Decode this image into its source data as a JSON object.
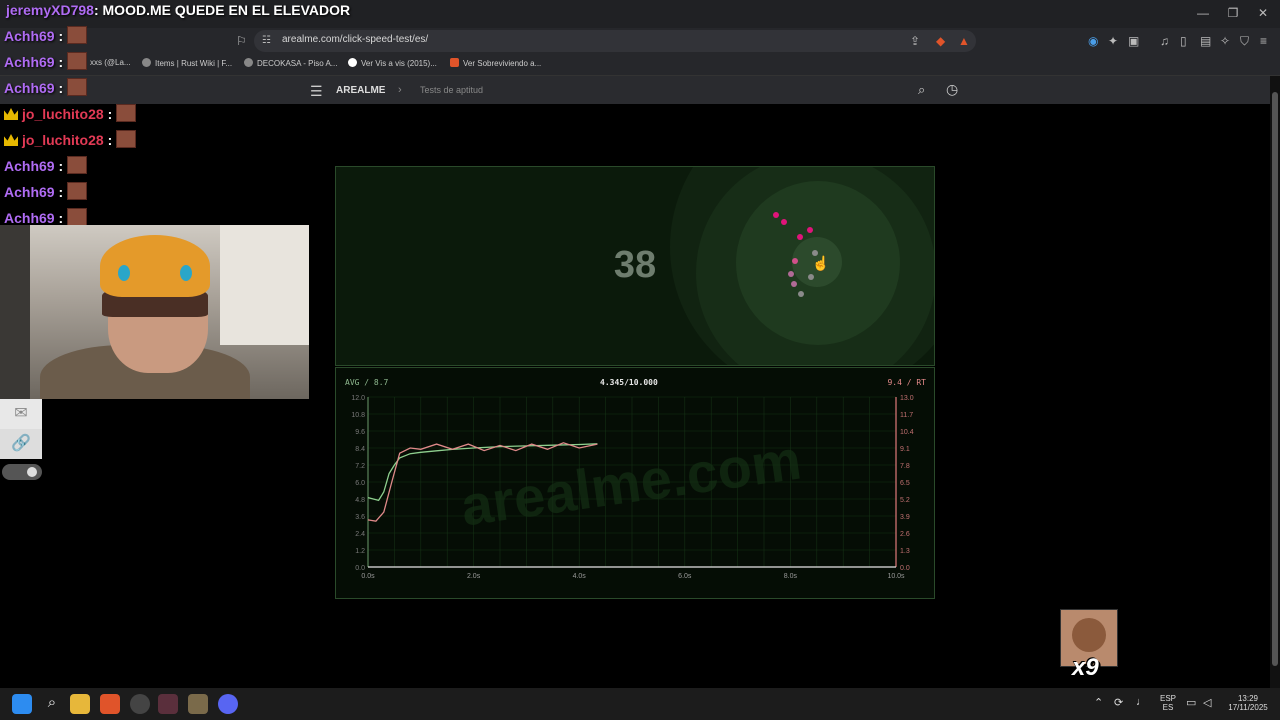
{
  "stream": {
    "title_user": "jeremyXD798",
    "title_sep": ": ",
    "title_text": "MOOD.ME QUEDE EN EL ELEVADOR",
    "chat": [
      {
        "user": "Achh69",
        "sep": ":"
      },
      {
        "user": "Achh69",
        "sep": ":"
      },
      {
        "user": "Achh69",
        "sep": ":"
      },
      {
        "user": "jo_luchito28",
        "sep": ":",
        "badge": "crown-icon"
      },
      {
        "user": "jo_luchito28",
        "sep": ":",
        "badge": "crown-icon"
      },
      {
        "user": "Achh69",
        "sep": ":"
      },
      {
        "user": "Achh69",
        "sep": ":"
      },
      {
        "user": "Achh69",
        "sep": ":"
      }
    ],
    "meme_multiplier": "x9"
  },
  "browser": {
    "url": "arealme.com/click-speed-test/es/",
    "bookmarks": [
      "xxs (@La...",
      "Items | Rust Wiki | F...",
      "DECOKASA - Piso A...",
      "Ver Vis a vis (2015)...",
      "Ver Sobreviviendo a..."
    ],
    "window_controls": [
      "—",
      "❐",
      "✕"
    ]
  },
  "site": {
    "brand": "AREALME",
    "breadcrumb": "Tests de aptitud",
    "click_count": "38",
    "avg_label": "AVG / 8.7",
    "progress_label": "4.345/10.000",
    "rt_label": "9.4 / RT"
  },
  "taskbar": {
    "lang_top": "ESP",
    "lang_bottom": "ES",
    "time": "13:29",
    "date": "17/11/2025"
  },
  "colors": {
    "avg_line": "#8fd08f",
    "rt_line": "#e08a8a",
    "click_dot": "#e0147a",
    "grid": "#143014"
  },
  "chart_data": {
    "type": "line",
    "xlim": [
      0,
      10
    ],
    "ylim_left": [
      0,
      12
    ],
    "ylim_right": [
      0,
      13
    ],
    "x_ticks": [
      "0.0s",
      "2.0s",
      "4.0s",
      "6.0s",
      "8.0s",
      "10.0s"
    ],
    "y_ticks_left": [
      "0.0",
      "1.2",
      "2.4",
      "3.6",
      "4.8",
      "6.0",
      "7.2",
      "8.4",
      "9.6",
      "10.8",
      "12.0"
    ],
    "y_ticks_right": [
      "0.0",
      "1.3",
      "2.6",
      "3.9",
      "5.2",
      "6.5",
      "7.8",
      "9.1",
      "10.4",
      "11.7",
      "13.0"
    ],
    "watermark": "arealme.com",
    "series": [
      {
        "name": "AVG",
        "axis": "left",
        "x": [
          0.0,
          0.1,
          0.2,
          0.3,
          0.4,
          0.5,
          0.6,
          0.8,
          1.0,
          1.3,
          1.6,
          2.0,
          2.5,
          3.0,
          3.5,
          4.0,
          4.345
        ],
        "y": [
          4.9,
          4.8,
          4.7,
          5.3,
          6.6,
          7.2,
          7.7,
          8.0,
          8.1,
          8.2,
          8.3,
          8.4,
          8.5,
          8.55,
          8.6,
          8.65,
          8.7
        ]
      },
      {
        "name": "RT",
        "axis": "right",
        "x": [
          0.0,
          0.15,
          0.3,
          0.45,
          0.6,
          0.8,
          1.0,
          1.3,
          1.6,
          1.9,
          2.2,
          2.5,
          2.8,
          3.1,
          3.4,
          3.7,
          4.0,
          4.345
        ],
        "y": [
          3.6,
          3.5,
          4.2,
          6.5,
          8.7,
          9.1,
          9.0,
          9.4,
          9.0,
          9.4,
          8.9,
          9.3,
          8.9,
          9.4,
          9.0,
          9.5,
          9.1,
          9.4
        ]
      }
    ]
  }
}
